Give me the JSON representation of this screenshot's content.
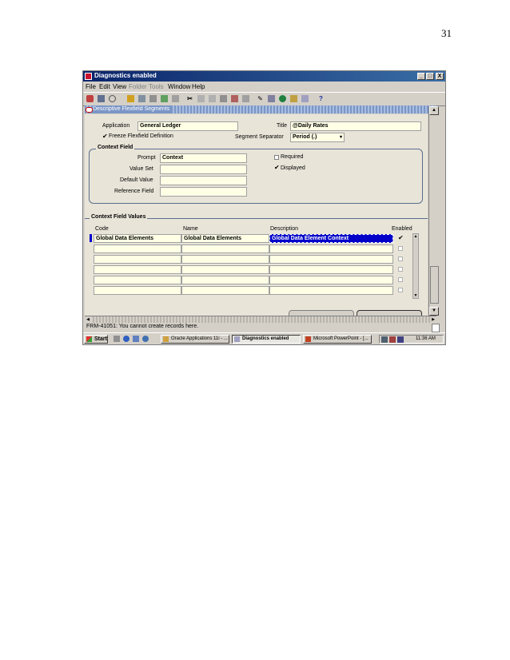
{
  "page_number": "31",
  "window": {
    "title": "Diagnostics enabled",
    "controls": [
      "_",
      "□",
      "X"
    ]
  },
  "menu": [
    {
      "label": "File",
      "enabled": true
    },
    {
      "label": "Edit",
      "enabled": true
    },
    {
      "label": "View",
      "enabled": true
    },
    {
      "label": "Folder",
      "enabled": false
    },
    {
      "label": "Tools",
      "enabled": false
    },
    {
      "label": "Window",
      "enabled": true
    },
    {
      "label": "Help",
      "enabled": true
    }
  ],
  "toolbar": {
    "help_glyph": "?"
  },
  "form_window": {
    "title": "Descriptive Flexfield Segments"
  },
  "header": {
    "application_label": "Application",
    "application_value": "General Ledger",
    "title_label": "Title",
    "title_value": "@Daily Rates",
    "freeze_label": "Freeze Flexfield Definition",
    "freeze_checked": true,
    "separator_label": "Segment Separator",
    "separator_value": "Period (.)"
  },
  "context_field": {
    "group_title": "Context Field",
    "prompt_label": "Prompt",
    "prompt_value": "Context",
    "value_set_label": "Value Set",
    "value_set_value": "",
    "default_value_label": "Default Value",
    "default_value_value": "",
    "reference_field_label": "Reference Field",
    "reference_field_value": "",
    "required_label": "Required",
    "required_checked": false,
    "displayed_label": "Displayed",
    "displayed_checked": true
  },
  "context_values": {
    "group_title": "Context Field Values",
    "columns": {
      "code": "Code",
      "name": "Name",
      "description": "Description",
      "enabled": "Enabled"
    },
    "rows": [
      {
        "code": "Global Data Elements",
        "name": "Global Data Elements",
        "description": "Global Data Element Context",
        "enabled": true
      },
      {
        "code": "",
        "name": "",
        "description": "",
        "enabled": false
      },
      {
        "code": "",
        "name": "",
        "description": "",
        "enabled": false
      },
      {
        "code": "",
        "name": "",
        "description": "",
        "enabled": false
      },
      {
        "code": "",
        "name": "",
        "description": "",
        "enabled": false
      },
      {
        "code": "",
        "name": "",
        "description": "",
        "enabled": false
      }
    ]
  },
  "status_bar": {
    "message": "FRM-41051: You cannot create records here."
  },
  "taskbar": {
    "start_label": "Start",
    "buttons": [
      {
        "label": "Oracle Applications 11i - ...",
        "active": false
      },
      {
        "label": "Diagnostics enabled",
        "active": true
      },
      {
        "label": "Microsoft PowerPoint - [...",
        "active": false
      }
    ],
    "clock": "11:36 AM"
  },
  "colors": {
    "title_bar": "#0a246a",
    "form_background": "#e8e4d8",
    "field_background": "#ffffe6",
    "selection": "#0000c8"
  }
}
